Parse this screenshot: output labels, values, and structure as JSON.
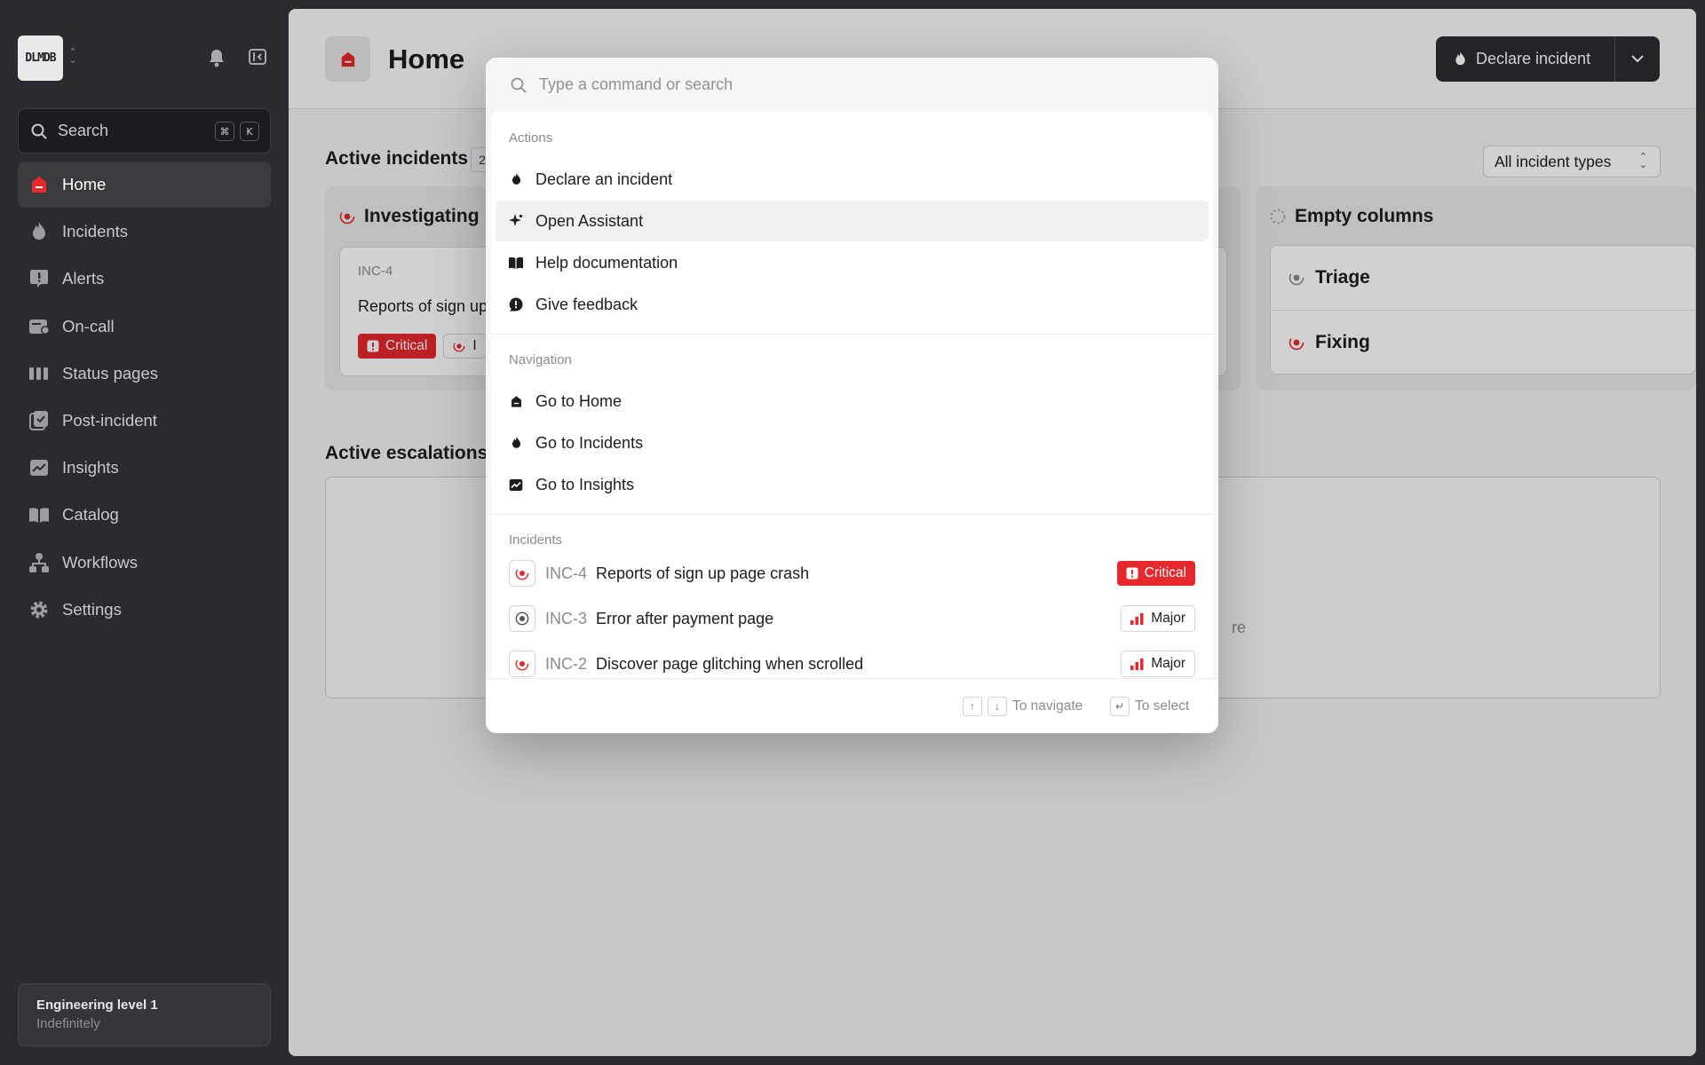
{
  "sidebar": {
    "logo_text": "DLMDB",
    "search": {
      "label": "Search",
      "shortcut_mod": "⌘",
      "shortcut_key": "K"
    },
    "items": [
      {
        "label": "Home",
        "icon": "home-icon",
        "active": true
      },
      {
        "label": "Incidents",
        "icon": "flame-icon"
      },
      {
        "label": "Alerts",
        "icon": "alert-icon"
      },
      {
        "label": "On-call",
        "icon": "oncall-icon"
      },
      {
        "label": "Status pages",
        "icon": "status-pages-icon"
      },
      {
        "label": "Post-incident",
        "icon": "post-incident-icon"
      },
      {
        "label": "Insights",
        "icon": "insights-icon"
      },
      {
        "label": "Catalog",
        "icon": "catalog-icon"
      },
      {
        "label": "Workflows",
        "icon": "workflows-icon"
      },
      {
        "label": "Settings",
        "icon": "gear-icon"
      }
    ],
    "profile": {
      "name": "Engineering level 1",
      "status": "Indefinitely"
    }
  },
  "header": {
    "title": "Home",
    "declare_label": "Declare incident"
  },
  "main": {
    "active_incidents_title": "Active incidents",
    "active_incidents_count": "2",
    "incident_types_label": "All incident types",
    "columns": {
      "investigating": {
        "label": "Investigating",
        "card": {
          "id": "INC-4",
          "title": "Reports of sign up",
          "severity": "Critical",
          "status_chip": "I"
        }
      },
      "empty": {
        "label": "Empty columns",
        "rows": [
          "Triage",
          "Fixing"
        ]
      }
    },
    "active_escalations_title": "Active escalations",
    "escalations_partial_text": "re"
  },
  "palette": {
    "placeholder": "Type a command or search",
    "groups": {
      "actions": {
        "label": "Actions",
        "items": [
          {
            "label": "Declare an incident",
            "icon": "flame-icon"
          },
          {
            "label": "Open Assistant",
            "icon": "sparkle-icon"
          },
          {
            "label": "Help documentation",
            "icon": "book-icon"
          },
          {
            "label": "Give feedback",
            "icon": "feedback-icon"
          }
        ]
      },
      "navigation": {
        "label": "Navigation",
        "items": [
          {
            "label": "Go to Home",
            "icon": "home-icon"
          },
          {
            "label": "Go to Incidents",
            "icon": "flame-icon"
          },
          {
            "label": "Go to Insights",
            "icon": "insights-icon"
          }
        ]
      },
      "incidents": {
        "label": "Incidents",
        "items": [
          {
            "id": "INC-4",
            "title": "Reports of sign up page crash",
            "severity": "Critical",
            "status": "investigating"
          },
          {
            "id": "INC-3",
            "title": "Error after payment page",
            "severity": "Major",
            "status": "monitoring"
          },
          {
            "id": "INC-2",
            "title": "Discover page glitching when scrolled",
            "severity": "Major",
            "status": "investigating"
          }
        ]
      }
    },
    "footer": {
      "up_key": "↑",
      "down_key": "↓",
      "navigate_label": "To navigate",
      "enter_key": "↵",
      "select_label": "To select"
    }
  },
  "colors": {
    "brand_red": "#e5292c",
    "sidebar_bg": "#2a2b30",
    "highlight": "#f1f1f3"
  }
}
